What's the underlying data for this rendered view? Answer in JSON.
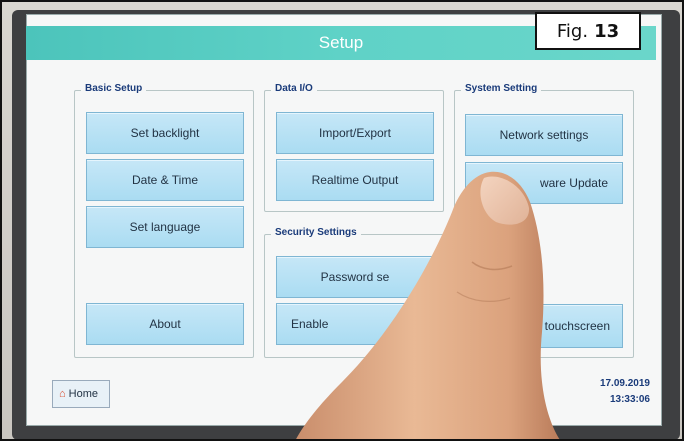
{
  "window": {
    "title": "Setup"
  },
  "groups": {
    "basic": {
      "label": "Basic Setup",
      "buttons": [
        "Set backlight",
        "Date & Time",
        "Set language",
        "About"
      ]
    },
    "data_io": {
      "label": "Data I/O",
      "buttons": [
        "Import/Export",
        "Realtime Output"
      ]
    },
    "security": {
      "label": "Security Settings",
      "buttons": [
        "Password se",
        "Enable"
      ]
    },
    "system": {
      "label": "System Setting",
      "buttons": [
        "Network settings",
        "ware Update",
        "Calibrate touchscreen"
      ]
    }
  },
  "footer": {
    "home_label": "Home",
    "date": "17.09.2019",
    "time": "13:33:06"
  },
  "figure": {
    "prefix": "Fig.",
    "number": "13"
  },
  "colors": {
    "title_bar": "#5fd2c7",
    "button": "#aadcf2",
    "group_label": "#1a3b7a"
  },
  "icons": {
    "home": "home-icon"
  }
}
